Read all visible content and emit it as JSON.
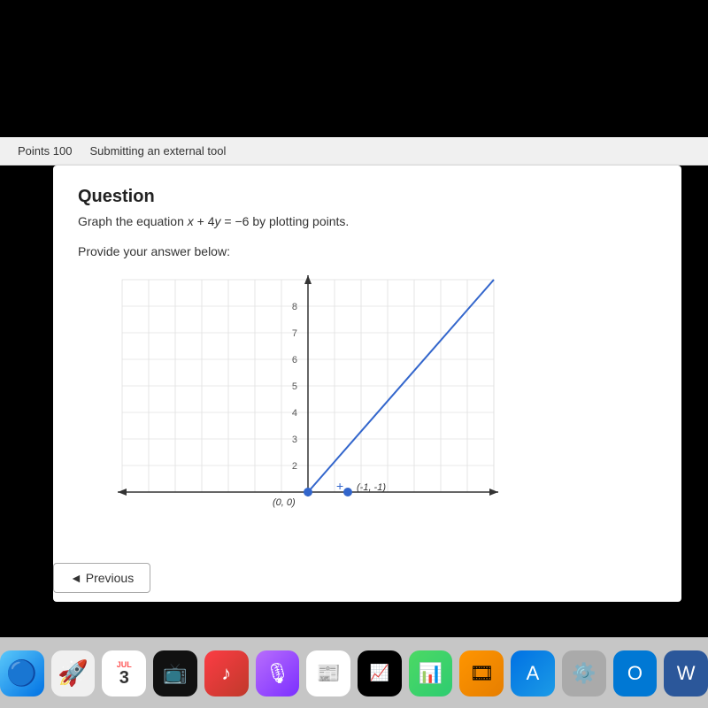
{
  "topbar": {
    "points_label": "Points 100",
    "submitting_label": "Submitting an external tool"
  },
  "question": {
    "title": "Question",
    "text": "Graph the equation x + 4y = −6 by plotting points.",
    "provide_label": "Provide your answer below:"
  },
  "graph": {
    "y_max": 8,
    "y_min": 0,
    "point1_label": "(0, 0)",
    "point2_label": "(-1, -1)"
  },
  "navigation": {
    "previous_label": "◄ Previous"
  },
  "dock": {
    "month": "JUL",
    "day": "3"
  }
}
